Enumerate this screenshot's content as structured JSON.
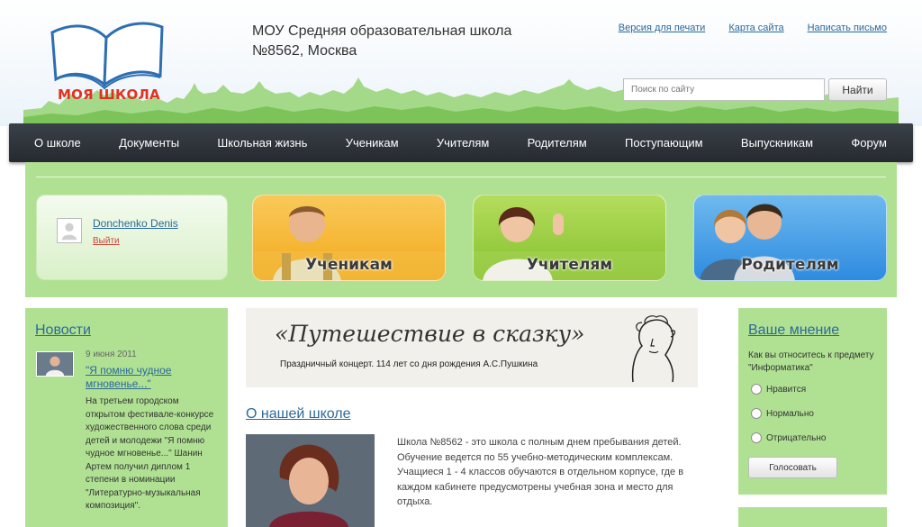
{
  "header": {
    "logo_text": "МОЯ ШКОЛА",
    "school_title_line1": "МОУ Средняя образовательная школа",
    "school_title_line2": "№8562, Москва",
    "top_links": [
      "Версия для печати",
      "Карта сайта",
      "Написать письмо"
    ],
    "search_placeholder": "Поиск по сайту",
    "search_button": "Найти"
  },
  "nav": {
    "items": [
      "О школе",
      "Документы",
      "Школьная жизнь",
      "Ученикам",
      "Учителям",
      "Родителям",
      "Поступающим",
      "Выпускникам",
      "Форум"
    ]
  },
  "user": {
    "name": "Donchenko Denis",
    "logout": "Выйти"
  },
  "categories": {
    "students": "Ученикам",
    "teachers": "Учителям",
    "parents": "Родителям"
  },
  "news": {
    "title": "Новости",
    "date": "9 июня 2011",
    "link": "\"Я помню чудное мгновенье...\"",
    "text": "На третьем городском открытом фестивале-конкурсе художественного слова среди детей и молодежи \"Я помню чудное мгновенье...\" Шанин Артем получил диплом 1 степени в номинации \"Литературно-музыкальная композиция\"."
  },
  "banner": {
    "title": "«Путешествие в сказку»",
    "subtitle": "Праздничный концерт. 114 лет со дня рождения А.С.Пушкина"
  },
  "about": {
    "title": "О нашей школе",
    "text": "Школа №8562 - это школа с полным днем пребывания детей. Обучение ведется по 55 учебно-методическим комплексам. Учащиеся 1 - 4 классов обучаются в отдельном корпусе, где в каждом кабинете предусмотрены учебная зона и место для отдыха."
  },
  "poll": {
    "title": "Ваше мнение",
    "question": "Как вы относитесь к предмету \"Информатика\"",
    "options": [
      "Нравится",
      "Нормально",
      "Отрицательно"
    ],
    "vote_button": "Голосовать"
  },
  "colors": {
    "accent_green": "#b0e193",
    "link_blue": "#2a6a9a",
    "nav_dark": "#2b3137",
    "logo_red": "#e2321f"
  }
}
